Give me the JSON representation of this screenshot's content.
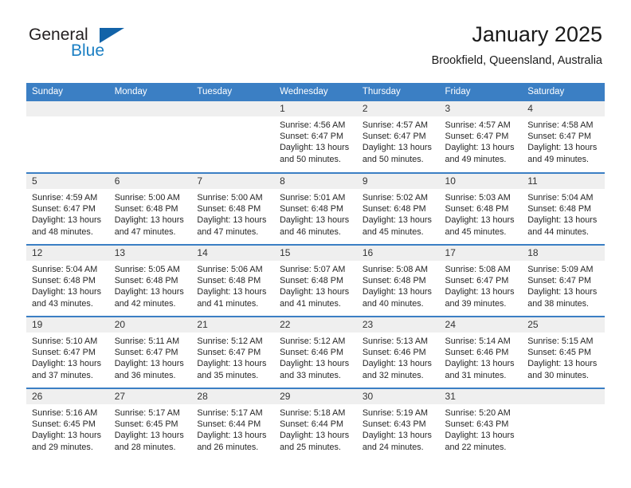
{
  "logo": {
    "word1": "General",
    "word2": "Blue",
    "triangle_color": "#1263a8",
    "word2_color": "#1b7fc3"
  },
  "header": {
    "title": "January 2025",
    "subtitle": "Brookfield, Queensland, Australia"
  },
  "theme": {
    "header_blue": "#3b7fc4",
    "daynum_bg": "#efefef",
    "text": "#262626"
  },
  "weekdays": [
    "Sunday",
    "Monday",
    "Tuesday",
    "Wednesday",
    "Thursday",
    "Friday",
    "Saturday"
  ],
  "weeks": [
    [
      {
        "day": "",
        "lines": []
      },
      {
        "day": "",
        "lines": []
      },
      {
        "day": "",
        "lines": []
      },
      {
        "day": "1",
        "lines": [
          "Sunrise: 4:56 AM",
          "Sunset: 6:47 PM",
          "Daylight: 13 hours",
          "and 50 minutes."
        ]
      },
      {
        "day": "2",
        "lines": [
          "Sunrise: 4:57 AM",
          "Sunset: 6:47 PM",
          "Daylight: 13 hours",
          "and 50 minutes."
        ]
      },
      {
        "day": "3",
        "lines": [
          "Sunrise: 4:57 AM",
          "Sunset: 6:47 PM",
          "Daylight: 13 hours",
          "and 49 minutes."
        ]
      },
      {
        "day": "4",
        "lines": [
          "Sunrise: 4:58 AM",
          "Sunset: 6:47 PM",
          "Daylight: 13 hours",
          "and 49 minutes."
        ]
      }
    ],
    [
      {
        "day": "5",
        "lines": [
          "Sunrise: 4:59 AM",
          "Sunset: 6:47 PM",
          "Daylight: 13 hours",
          "and 48 minutes."
        ]
      },
      {
        "day": "6",
        "lines": [
          "Sunrise: 5:00 AM",
          "Sunset: 6:48 PM",
          "Daylight: 13 hours",
          "and 47 minutes."
        ]
      },
      {
        "day": "7",
        "lines": [
          "Sunrise: 5:00 AM",
          "Sunset: 6:48 PM",
          "Daylight: 13 hours",
          "and 47 minutes."
        ]
      },
      {
        "day": "8",
        "lines": [
          "Sunrise: 5:01 AM",
          "Sunset: 6:48 PM",
          "Daylight: 13 hours",
          "and 46 minutes."
        ]
      },
      {
        "day": "9",
        "lines": [
          "Sunrise: 5:02 AM",
          "Sunset: 6:48 PM",
          "Daylight: 13 hours",
          "and 45 minutes."
        ]
      },
      {
        "day": "10",
        "lines": [
          "Sunrise: 5:03 AM",
          "Sunset: 6:48 PM",
          "Daylight: 13 hours",
          "and 45 minutes."
        ]
      },
      {
        "day": "11",
        "lines": [
          "Sunrise: 5:04 AM",
          "Sunset: 6:48 PM",
          "Daylight: 13 hours",
          "and 44 minutes."
        ]
      }
    ],
    [
      {
        "day": "12",
        "lines": [
          "Sunrise: 5:04 AM",
          "Sunset: 6:48 PM",
          "Daylight: 13 hours",
          "and 43 minutes."
        ]
      },
      {
        "day": "13",
        "lines": [
          "Sunrise: 5:05 AM",
          "Sunset: 6:48 PM",
          "Daylight: 13 hours",
          "and 42 minutes."
        ]
      },
      {
        "day": "14",
        "lines": [
          "Sunrise: 5:06 AM",
          "Sunset: 6:48 PM",
          "Daylight: 13 hours",
          "and 41 minutes."
        ]
      },
      {
        "day": "15",
        "lines": [
          "Sunrise: 5:07 AM",
          "Sunset: 6:48 PM",
          "Daylight: 13 hours",
          "and 41 minutes."
        ]
      },
      {
        "day": "16",
        "lines": [
          "Sunrise: 5:08 AM",
          "Sunset: 6:48 PM",
          "Daylight: 13 hours",
          "and 40 minutes."
        ]
      },
      {
        "day": "17",
        "lines": [
          "Sunrise: 5:08 AM",
          "Sunset: 6:47 PM",
          "Daylight: 13 hours",
          "and 39 minutes."
        ]
      },
      {
        "day": "18",
        "lines": [
          "Sunrise: 5:09 AM",
          "Sunset: 6:47 PM",
          "Daylight: 13 hours",
          "and 38 minutes."
        ]
      }
    ],
    [
      {
        "day": "19",
        "lines": [
          "Sunrise: 5:10 AM",
          "Sunset: 6:47 PM",
          "Daylight: 13 hours",
          "and 37 minutes."
        ]
      },
      {
        "day": "20",
        "lines": [
          "Sunrise: 5:11 AM",
          "Sunset: 6:47 PM",
          "Daylight: 13 hours",
          "and 36 minutes."
        ]
      },
      {
        "day": "21",
        "lines": [
          "Sunrise: 5:12 AM",
          "Sunset: 6:47 PM",
          "Daylight: 13 hours",
          "and 35 minutes."
        ]
      },
      {
        "day": "22",
        "lines": [
          "Sunrise: 5:12 AM",
          "Sunset: 6:46 PM",
          "Daylight: 13 hours",
          "and 33 minutes."
        ]
      },
      {
        "day": "23",
        "lines": [
          "Sunrise: 5:13 AM",
          "Sunset: 6:46 PM",
          "Daylight: 13 hours",
          "and 32 minutes."
        ]
      },
      {
        "day": "24",
        "lines": [
          "Sunrise: 5:14 AM",
          "Sunset: 6:46 PM",
          "Daylight: 13 hours",
          "and 31 minutes."
        ]
      },
      {
        "day": "25",
        "lines": [
          "Sunrise: 5:15 AM",
          "Sunset: 6:45 PM",
          "Daylight: 13 hours",
          "and 30 minutes."
        ]
      }
    ],
    [
      {
        "day": "26",
        "lines": [
          "Sunrise: 5:16 AM",
          "Sunset: 6:45 PM",
          "Daylight: 13 hours",
          "and 29 minutes."
        ]
      },
      {
        "day": "27",
        "lines": [
          "Sunrise: 5:17 AM",
          "Sunset: 6:45 PM",
          "Daylight: 13 hours",
          "and 28 minutes."
        ]
      },
      {
        "day": "28",
        "lines": [
          "Sunrise: 5:17 AM",
          "Sunset: 6:44 PM",
          "Daylight: 13 hours",
          "and 26 minutes."
        ]
      },
      {
        "day": "29",
        "lines": [
          "Sunrise: 5:18 AM",
          "Sunset: 6:44 PM",
          "Daylight: 13 hours",
          "and 25 minutes."
        ]
      },
      {
        "day": "30",
        "lines": [
          "Sunrise: 5:19 AM",
          "Sunset: 6:43 PM",
          "Daylight: 13 hours",
          "and 24 minutes."
        ]
      },
      {
        "day": "31",
        "lines": [
          "Sunrise: 5:20 AM",
          "Sunset: 6:43 PM",
          "Daylight: 13 hours",
          "and 22 minutes."
        ]
      },
      {
        "day": "",
        "lines": []
      }
    ]
  ]
}
